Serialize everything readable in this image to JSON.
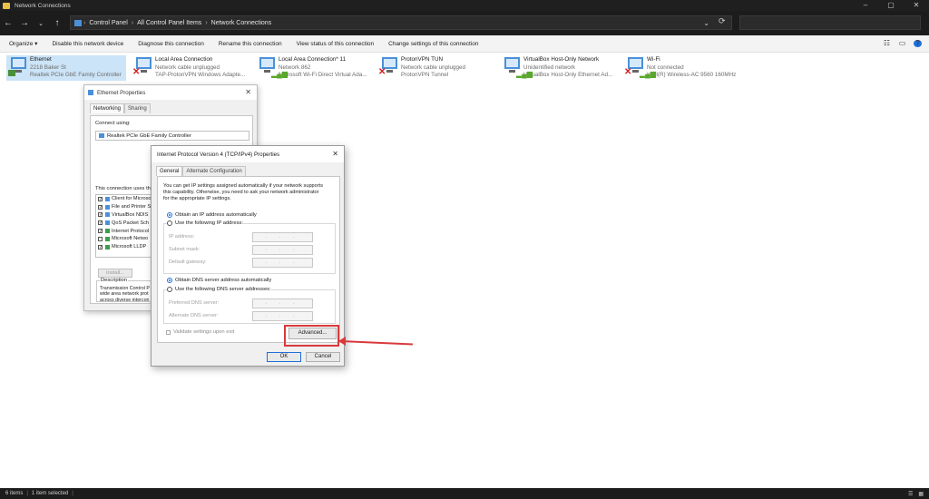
{
  "window": {
    "title": "Network Connections"
  },
  "address": {
    "crumbs": [
      "Control Panel",
      "All Control Panel Items",
      "Network Connections"
    ]
  },
  "commandbar": {
    "organize": "Organize ▾",
    "disable": "Disable this network device",
    "diagnose": "Diagnose this connection",
    "rename": "Rename this connection",
    "view_status": "View status of this connection",
    "change_settings": "Change settings of this connection"
  },
  "adapters": [
    {
      "name": "Ethernet",
      "line2": "2218 Baker St",
      "line3": "Realtek PCIe GbE Family Controller",
      "status": "connected"
    },
    {
      "name": "Local Area Connection",
      "line2": "Network cable unplugged",
      "line3": "TAP-ProtonVPN Windows Adapte...",
      "status": "disconnected"
    },
    {
      "name": "Local Area Connection* 11",
      "line2": "Network 862",
      "line3": "Microsoft Wi-Fi Direct Virtual Ada...",
      "status": "connected"
    },
    {
      "name": "ProtonVPN TUN",
      "line2": "Network cable unplugged",
      "line3": "ProtonVPN Tunnel",
      "status": "disconnected"
    },
    {
      "name": "VirtualBox Host-Only Network",
      "line2": "Unidentified network",
      "line3": "VirtualBox Host-Only Ethernet Ad...",
      "status": "connected"
    },
    {
      "name": "Wi-Fi",
      "line2": "Not connected",
      "line3": "Intel(R) Wireless-AC 9560 160MHz",
      "status": "disconnected"
    }
  ],
  "eth_dialog": {
    "title": "Ethernet Properties",
    "tab_networking": "Networking",
    "tab_sharing": "Sharing",
    "connect_using": "Connect using:",
    "adapter": "Realtek PCIe GbE Family Controller",
    "uses_label": "This connection uses the",
    "components": [
      {
        "label": "Client for Microso",
        "checked": true
      },
      {
        "label": "File and Printer S",
        "checked": true
      },
      {
        "label": "VirtualBox NDIS",
        "checked": true
      },
      {
        "label": "QoS Packet Sch",
        "checked": true
      },
      {
        "label": "Internet Protocol",
        "checked": true
      },
      {
        "label": "Microsoft Netwo",
        "checked": false
      },
      {
        "label": "Microsoft LLDP",
        "checked": true
      }
    ],
    "install": "Install...",
    "description_label": "Description",
    "description": [
      "Transmission Control P",
      "wide area network prot",
      "across diverse intercon"
    ]
  },
  "ip_dialog": {
    "title": "Internet Protocol Version 4 (TCP/IPv4) Properties",
    "tab_general": "General",
    "tab_alternate": "Alternate Configuration",
    "intro": [
      "You can get IP settings assigned automatically if your network supports",
      "this capability. Otherwise, you need to ask your network administrator",
      "for the appropriate IP settings."
    ],
    "obtain_ip": "Obtain an IP address automatically",
    "use_ip": "Use the following IP address:",
    "ip_label": "IP address:",
    "subnet_label": "Subnet mask:",
    "gateway_label": "Default gateway:",
    "obtain_dns": "Obtain DNS server address automatically",
    "use_dns": "Use the following DNS server addresses:",
    "preferred_dns": "Preferred DNS server:",
    "alternate_dns": "Alternate DNS server:",
    "ip_field_placeholder": ". . .",
    "validate": "Validate settings upon exit",
    "advanced": "Advanced...",
    "ok": "OK",
    "cancel": "Cancel"
  },
  "status": {
    "items": "6 items",
    "selected": "1 item selected"
  },
  "colors": {
    "highlight": "#d9393b",
    "accent": "#1e6fd9",
    "selection": "#cce4f7"
  }
}
